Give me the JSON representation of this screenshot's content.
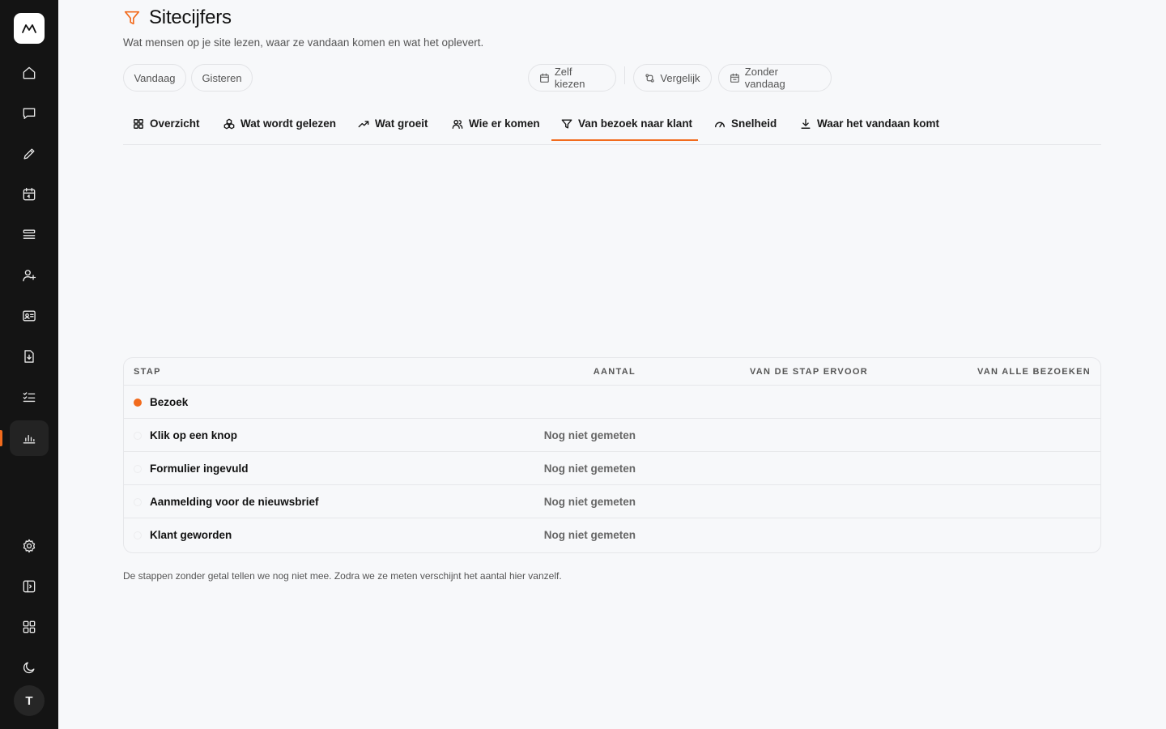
{
  "app": {
    "logo_icon": "brand-m-logo",
    "avatar_initial": "T",
    "accent_color": "#f26b1d"
  },
  "sidebar": {
    "items": [
      {
        "name": "home-icon"
      },
      {
        "name": "chat-icon"
      },
      {
        "name": "pencil-icon"
      },
      {
        "name": "calendar-icon"
      },
      {
        "name": "stack-icon"
      },
      {
        "name": "user-plus-icon"
      },
      {
        "name": "contact-card-icon"
      },
      {
        "name": "file-download-icon"
      },
      {
        "name": "checklist-icon"
      },
      {
        "name": "bar-chart-icon",
        "active": true
      }
    ],
    "bottom_items": [
      {
        "name": "settings-icon"
      },
      {
        "name": "sidebar-toggle-icon"
      },
      {
        "name": "grid-icon"
      },
      {
        "name": "moon-icon"
      }
    ]
  },
  "header": {
    "title": "Sitecijfers",
    "subtitle": "Wat mensen op je site lezen, waar ze vandaan komen en wat het oplevert."
  },
  "filters": {
    "today": "Vandaag",
    "yesterday": "Gisteren",
    "custom": "Zelf kiezen",
    "compare": "Vergelijk",
    "exclude_today": "Zonder vandaag"
  },
  "tabs": [
    {
      "label": "Overzicht",
      "icon": "grid-icon"
    },
    {
      "label": "Wat wordt gelezen",
      "icon": "cubes-icon"
    },
    {
      "label": "Wat groeit",
      "icon": "trend-up-icon"
    },
    {
      "label": "Wie er komen",
      "icon": "users-icon"
    },
    {
      "label": "Van bezoek naar klant",
      "icon": "funnel-icon",
      "active": true
    },
    {
      "label": "Snelheid",
      "icon": "gauge-icon"
    },
    {
      "label": "Waar het vandaan komt",
      "icon": "download-icon"
    }
  ],
  "table": {
    "headers": {
      "step": "STAP",
      "count": "AANTAL",
      "from_prev": "VAN DE STAP ERVOOR",
      "from_all": "VAN ALLE BEZOEKEN"
    },
    "rows": [
      {
        "label": "Bezoek",
        "count": "",
        "active": true
      },
      {
        "label": "Klik op een knop",
        "count": "Nog niet gemeten"
      },
      {
        "label": "Formulier ingevuld",
        "count": "Nog niet gemeten"
      },
      {
        "label": "Aanmelding voor de nieuwsbrief",
        "count": "Nog niet gemeten"
      },
      {
        "label": "Klant geworden",
        "count": "Nog niet gemeten"
      }
    ]
  },
  "footnote": "De stappen zonder getal tellen we nog niet mee. Zodra we ze meten verschijnt het aantal hier vanzelf."
}
